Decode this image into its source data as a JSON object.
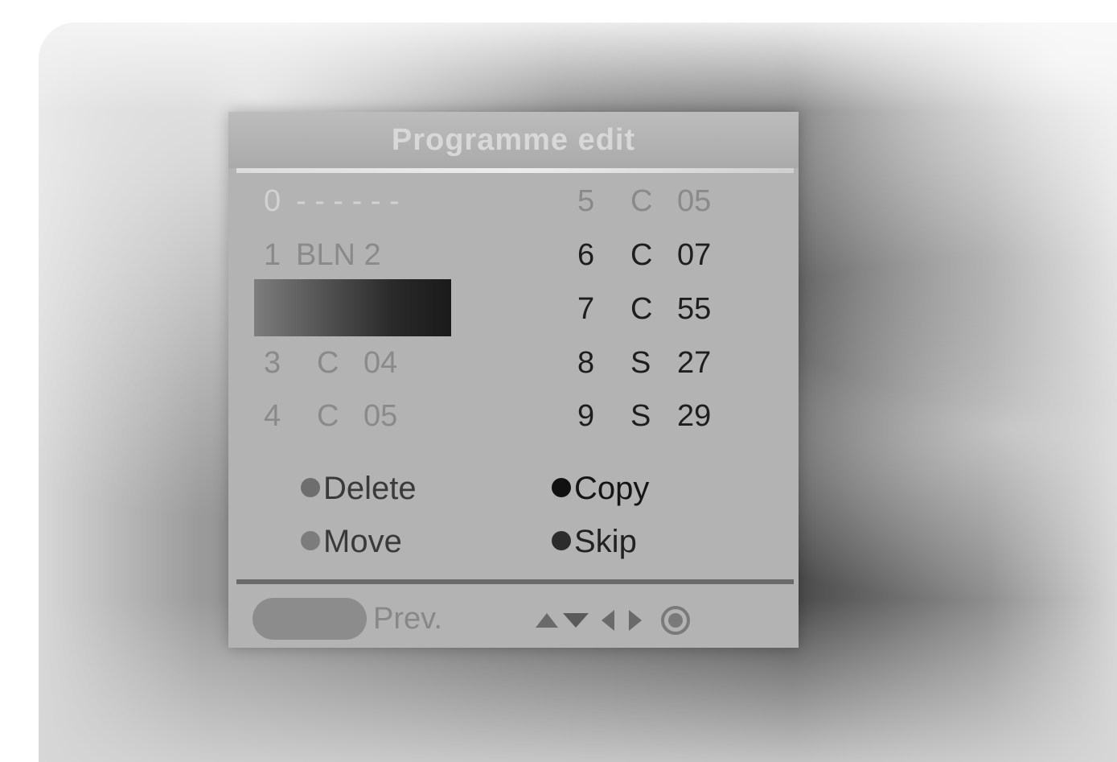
{
  "menu": {
    "title": "Programme edit",
    "left_rows": [
      {
        "num": "0",
        "band": "",
        "ch": "- - - - - -"
      },
      {
        "num": "1",
        "band": "",
        "ch": "BLN 2"
      },
      {
        "num": "",
        "band": "",
        "ch": ""
      },
      {
        "num": "3",
        "band": "C",
        "ch": "04"
      },
      {
        "num": "4",
        "band": "C",
        "ch": "05"
      }
    ],
    "right_rows": [
      {
        "num": "5",
        "band": "C",
        "ch": "05"
      },
      {
        "num": "6",
        "band": "C",
        "ch": "07"
      },
      {
        "num": "7",
        "band": "C",
        "ch": "55"
      },
      {
        "num": "8",
        "band": "S",
        "ch": "27"
      },
      {
        "num": "9",
        "band": "S",
        "ch": "29"
      }
    ],
    "options": {
      "delete": "Delete",
      "copy": "Copy",
      "move": "Move",
      "skip": "Skip"
    },
    "footer": {
      "prev": "Prev."
    }
  },
  "colors": {
    "delete_bullet": "#6e6e6e",
    "copy_bullet": "#111111",
    "move_bullet": "#7c7c7c",
    "skip_bullet": "#2c2c2c",
    "highlight": "#1a1a1a"
  },
  "icons": [
    "up-arrow-icon",
    "down-arrow-icon",
    "left-arrow-icon",
    "right-arrow-icon",
    "ok-icon"
  ]
}
